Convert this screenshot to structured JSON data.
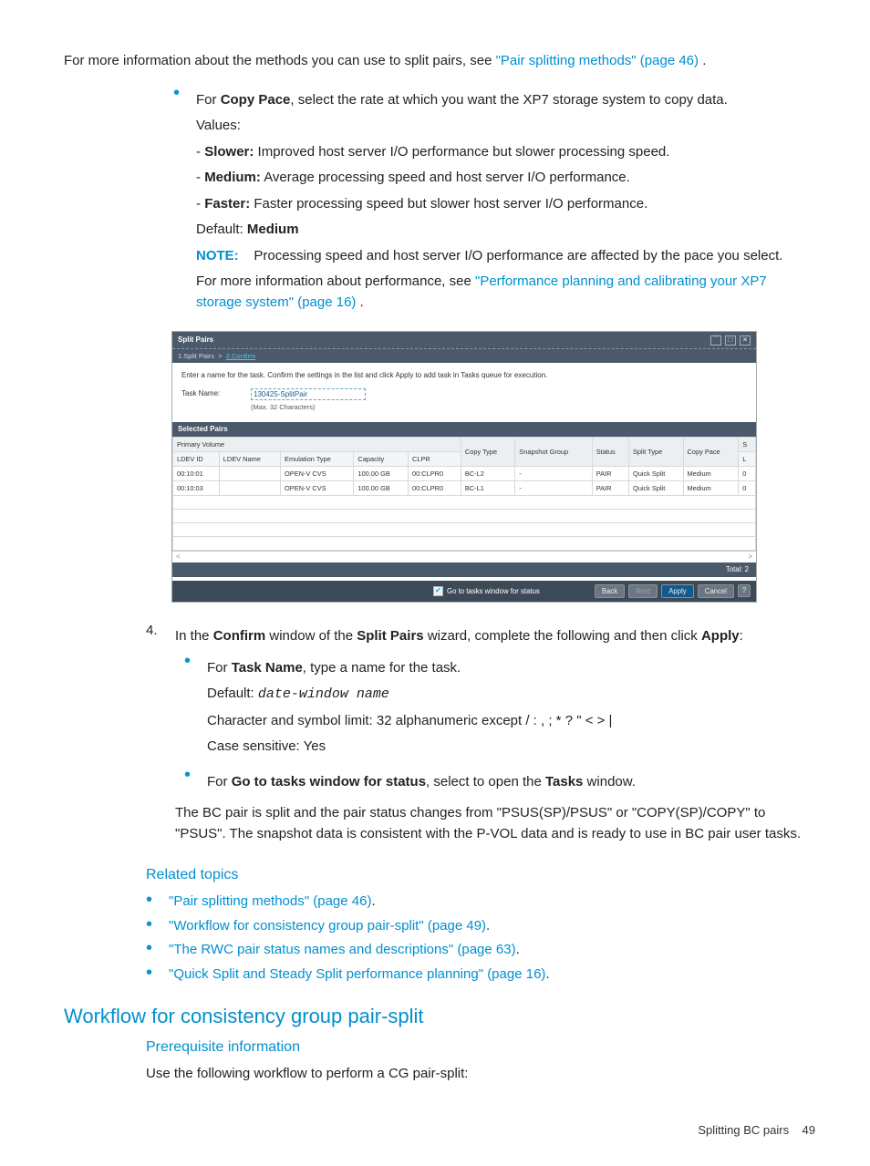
{
  "top": {
    "para1_a": "For more information about the methods you can use to split pairs, see ",
    "para1_link": "\"Pair splitting methods\" (page 46)",
    "para1_b": "."
  },
  "copy_pace": {
    "intro_a": "For ",
    "cp_bold": "Copy Pace",
    "intro_b": ", select the rate at which you want the XP7 storage system to copy data.",
    "values_label": "Values:",
    "slower_label": "Slower:",
    "slower_text": " Improved host server I/O performance but slower processing speed.",
    "medium_label": "Medium:",
    "medium_text": " Average processing speed and host server I/O performance.",
    "faster_label": "Faster:",
    "faster_text": " Faster processing speed but slower host server I/O performance.",
    "default_a": "Default: ",
    "default_b": "Medium",
    "note_label": "NOTE:",
    "note_text": " Processing speed and host server I/O performance are affected by the pace you select.",
    "perf_a": "For more information about performance, see ",
    "perf_link": "\"Performance planning and calibrating your XP7 storage system\" (page 16)",
    "perf_b": "."
  },
  "dialog": {
    "title": "Split Pairs",
    "step1": "1.Split Pairs",
    "sep": ">",
    "step2": "2.Confirm",
    "instr": "Enter a name for the task. Confirm the settings in the list and click Apply to add task in Tasks queue for execution.",
    "task_label": "Task Name:",
    "task_value": "130425-SplitPair",
    "task_hint": "(Max. 32 Characters)",
    "sel_hdr": "Selected Pairs",
    "group_primary": "Primary Volume",
    "cols": {
      "ldev_id": "LDEV ID",
      "ldev_name": "LDEV Name",
      "emu": "Emulation Type",
      "cap": "Capacity",
      "clpr": "CLPR",
      "copytype": "Copy Type",
      "snap": "Snapshot Group",
      "status": "Status",
      "splittype": "Split Type",
      "copypace": "Copy Pace",
      "s": "S",
      "l": "L"
    },
    "rows": [
      {
        "ldev_id": "00:10:01",
        "ldev_name": "",
        "emu": "OPEN-V CVS",
        "cap": "100.00 GB",
        "clpr": "00:CLPR0",
        "copytype": "BC-L2",
        "snap": "-",
        "status": "PAIR",
        "splittype": "Quick Split",
        "copypace": "Medium",
        "s": "0"
      },
      {
        "ldev_id": "00:10:03",
        "ldev_name": "",
        "emu": "OPEN-V CVS",
        "cap": "100.00 GB",
        "clpr": "00:CLPR0",
        "copytype": "BC-L1",
        "snap": "-",
        "status": "PAIR",
        "splittype": "Quick Split",
        "copypace": "Medium",
        "s": "0"
      }
    ],
    "scroll_left": "<",
    "scroll_right": ">",
    "total": "Total: 2",
    "chk_label": "Go to tasks window for status",
    "btn_back": "Back",
    "btn_next": "Next ",
    "btn_apply": "Apply",
    "btn_cancel": "Cancel",
    "btn_help": "?"
  },
  "step4": {
    "num": "4.",
    "line_a": "In the ",
    "b1": "Confirm",
    "line_b": " window of the ",
    "b2": "Split Pairs",
    "line_c": " wizard, complete the following and then click ",
    "b3": "Apply",
    "line_d": ":",
    "task_a": "For ",
    "task_b": "Task Name",
    "task_c": ", type a name for the task.",
    "task_default_a": "Default: ",
    "task_default_mono": "date-window name",
    "task_limit": "Character and symbol limit: 32 alphanumeric except / : , ; * ? \" < > |",
    "task_case": "Case sensitive: Yes",
    "goto_a": "For ",
    "goto_b": "Go to tasks window for status",
    "goto_c": ", select to open the ",
    "goto_d": "Tasks",
    "goto_e": " window.",
    "result": "The BC pair is split and the pair status changes from \"PSUS(SP)/PSUS\" or \"COPY(SP)/COPY\" to \"PSUS\". The snapshot data is consistent with the P-VOL data and is ready to use in BC pair user tasks."
  },
  "related": {
    "heading": "Related topics",
    "items": [
      "\"Pair splitting methods\" (page 46)",
      "\"Workflow for consistency group pair-split\" (page 49)",
      "\"The RWC pair status names and descriptions\" (page 63)",
      "\"Quick Split and Steady Split performance planning\" (page 16)"
    ],
    "dot_after": "."
  },
  "section2": {
    "h2": "Workflow for consistency group pair-split",
    "sub": "Prerequisite information",
    "text": "Use the following workflow to perform a CG pair-split:"
  },
  "footer": {
    "label": "Splitting BC pairs",
    "page": "49"
  }
}
